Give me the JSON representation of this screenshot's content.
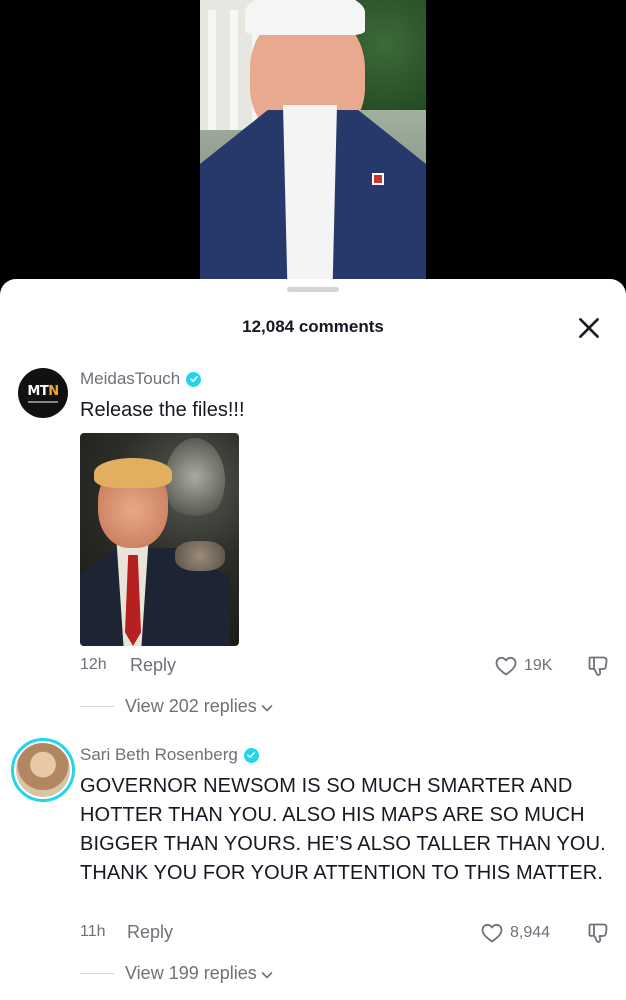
{
  "video": {
    "description_icons": [
      "video-frame"
    ]
  },
  "sheet": {
    "title": "12,084 comments",
    "close_icon": "close-icon"
  },
  "comments": [
    {
      "username": "MeidasTouch",
      "verified": true,
      "avatar_text": "MTN",
      "text": "Release the files!!!",
      "has_image": true,
      "time": "12h",
      "reply_label": "Reply",
      "likes": "19K",
      "view_replies": "View 202 replies"
    },
    {
      "username": "Sari Beth Rosenberg",
      "verified": true,
      "text": "GOVERNOR NEWSOM IS SO MUCH SMARTER AND HOTTER THAN YOU. ALSO HIS MAPS ARE SO MUCH BIGGER THAN YOURS. HE’S ALSO TALLER THAN YOU. THANK YOU FOR YOUR ATTENTION TO THIS MATTER.",
      "time": "11h",
      "reply_label": "Reply",
      "likes": "8,944",
      "view_replies": "View 199 replies"
    }
  ],
  "colors": {
    "verified": "#20d5ec",
    "text_primary": "#161823",
    "text_secondary": "#6f7079"
  }
}
